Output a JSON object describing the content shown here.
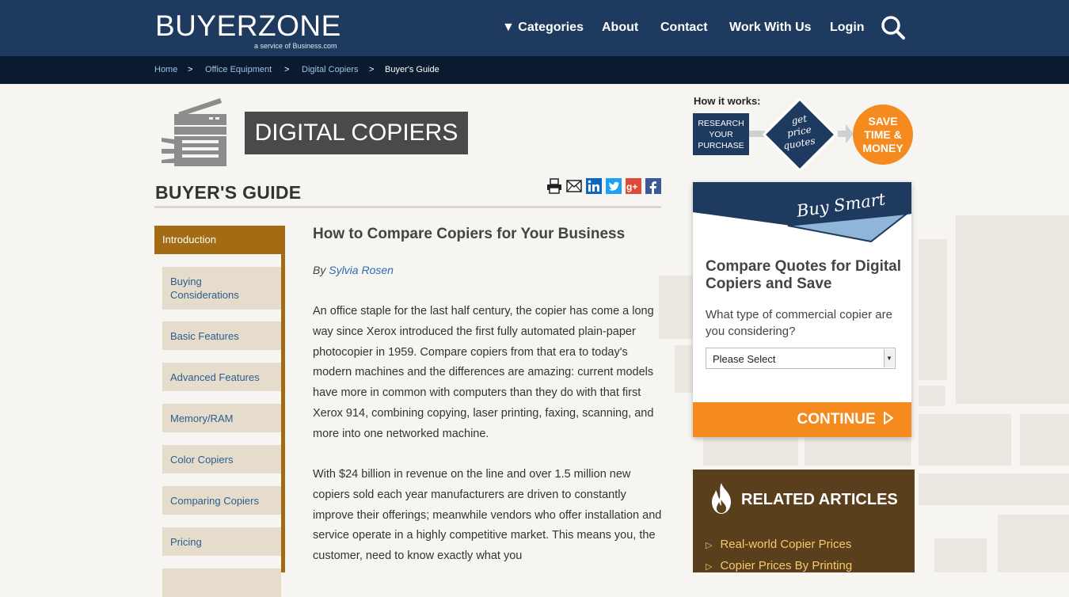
{
  "header": {
    "logo": "BUYERZONE",
    "logo_sub": "a service of Business.com",
    "nav": [
      "▼ Categories",
      "About",
      "Contact",
      "Work With Us",
      "Login"
    ]
  },
  "breadcrumb": [
    "Home",
    "Office Equipment",
    "Digital Copiers",
    "Buyer's Guide"
  ],
  "page": {
    "title": "DIGITAL COPIERS",
    "guide_title": "BUYER'S GUIDE"
  },
  "share_icons": [
    "print-icon",
    "email-icon",
    "linkedin-icon",
    "twitter-icon",
    "googleplus-icon",
    "facebook-icon"
  ],
  "sidebar": {
    "active": "Introduction",
    "items": [
      "Buying Considerations",
      "Basic Features",
      "Advanced Features",
      "Memory/RAM",
      "Color Copiers",
      "Comparing Copiers",
      "Pricing"
    ]
  },
  "article": {
    "title": "How to Compare Copiers for Your Business",
    "by": "By",
    "author": "Sylvia Rosen",
    "paragraphs": [
      "An office staple for the last half century, the copier has come a long way since Xerox introduced the first fully automated plain-paper photocopier in 1959. Compare copiers from that era to today's modern machines and the differences are amazing: current models have more in common with computers than they do with that first Xerox 914, combining copying, laser printing, faxing, scanning, and more into one networked machine.",
      "With $24 billion in revenue on the line and over 1.5 million new copiers sold each year manufacturers are driven to constantly improve their offerings; meanwhile vendors who offer installation and service operate in a highly competitive market. This means you, the customer, need to know exactly what you"
    ]
  },
  "how_it_works": {
    "label": "How it works:",
    "step1": "RESEARCH YOUR PURCHASE",
    "step2": [
      "get",
      "price",
      "quotes"
    ],
    "step3": [
      "SAVE",
      "TIME &",
      "MONEY"
    ]
  },
  "quote_widget": {
    "banner": "Buy Smart",
    "heading": "Compare Quotes for Digital Copiers and Save",
    "question": "What type of commercial copier are you considering?",
    "select_value": "Please Select",
    "button": "CONTINUE"
  },
  "related": {
    "heading": "RELATED ARTICLES",
    "items": [
      "Real-world Copier Prices",
      "Copier Prices By Printing"
    ]
  },
  "colors": {
    "nav_bg": "#1e3a5f",
    "breadcrumb_bg": "#0b1a2e",
    "sidebar_active": "#a36b14",
    "sidebar_item_bg": "#e6dccb",
    "orange": "#f58a1f",
    "related_bg": "#5a3f1d"
  }
}
